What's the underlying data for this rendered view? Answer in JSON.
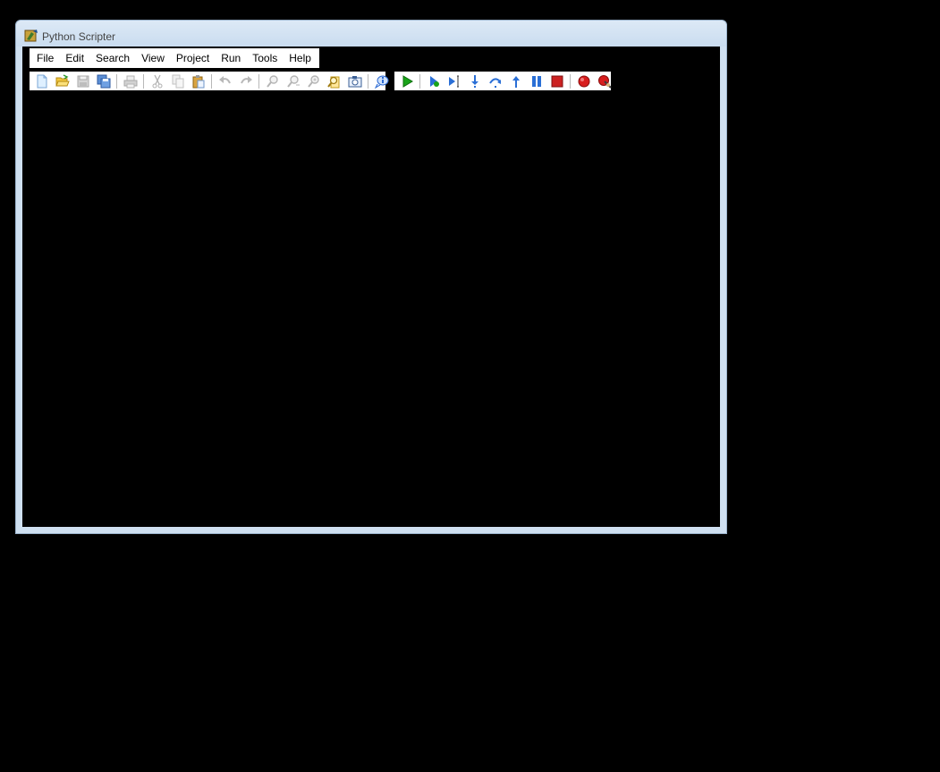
{
  "window": {
    "title": "Python Scripter"
  },
  "menu": {
    "items": [
      {
        "label": "File"
      },
      {
        "label": "Edit"
      },
      {
        "label": "Search"
      },
      {
        "label": "View"
      },
      {
        "label": "Project"
      },
      {
        "label": "Run"
      },
      {
        "label": "Tools"
      },
      {
        "label": "Help"
      }
    ]
  },
  "toolbar_main": {
    "buttons": [
      {
        "icon": "new-file-icon",
        "enabled": true
      },
      {
        "icon": "open-folder-icon",
        "enabled": true
      },
      {
        "icon": "save-icon",
        "enabled": false
      },
      {
        "icon": "save-all-icon",
        "enabled": true
      },
      {
        "icon": "print-icon",
        "enabled": false
      },
      {
        "icon": "cut-icon",
        "enabled": false
      },
      {
        "icon": "copy-icon",
        "enabled": false
      },
      {
        "icon": "paste-icon",
        "enabled": true
      },
      {
        "icon": "undo-icon",
        "enabled": false
      },
      {
        "icon": "redo-icon",
        "enabled": false
      },
      {
        "icon": "find-icon",
        "enabled": false
      },
      {
        "icon": "find-next-icon",
        "enabled": false
      },
      {
        "icon": "replace-icon",
        "enabled": false
      },
      {
        "icon": "find-in-files-icon",
        "enabled": true
      },
      {
        "icon": "camera-icon",
        "enabled": true
      },
      {
        "icon": "info-icon",
        "enabled": true
      }
    ]
  },
  "toolbar_debug": {
    "buttons": [
      {
        "icon": "run-icon",
        "enabled": true
      },
      {
        "icon": "debug-icon",
        "enabled": true
      },
      {
        "icon": "run-to-cursor-icon",
        "enabled": true
      },
      {
        "icon": "step-into-icon",
        "enabled": true
      },
      {
        "icon": "step-over-icon",
        "enabled": true
      },
      {
        "icon": "step-out-icon",
        "enabled": true
      },
      {
        "icon": "pause-icon",
        "enabled": true
      },
      {
        "icon": "stop-icon",
        "enabled": true
      },
      {
        "icon": "toggle-breakpoint-icon",
        "enabled": true
      },
      {
        "icon": "clear-breakpoints-icon",
        "enabled": true
      }
    ]
  },
  "colors": {
    "run_green": "#19a319",
    "debug_blue": "#2a6fd6",
    "stop_red": "#cc2222",
    "breakpoint_red": "#d81e1e"
  }
}
